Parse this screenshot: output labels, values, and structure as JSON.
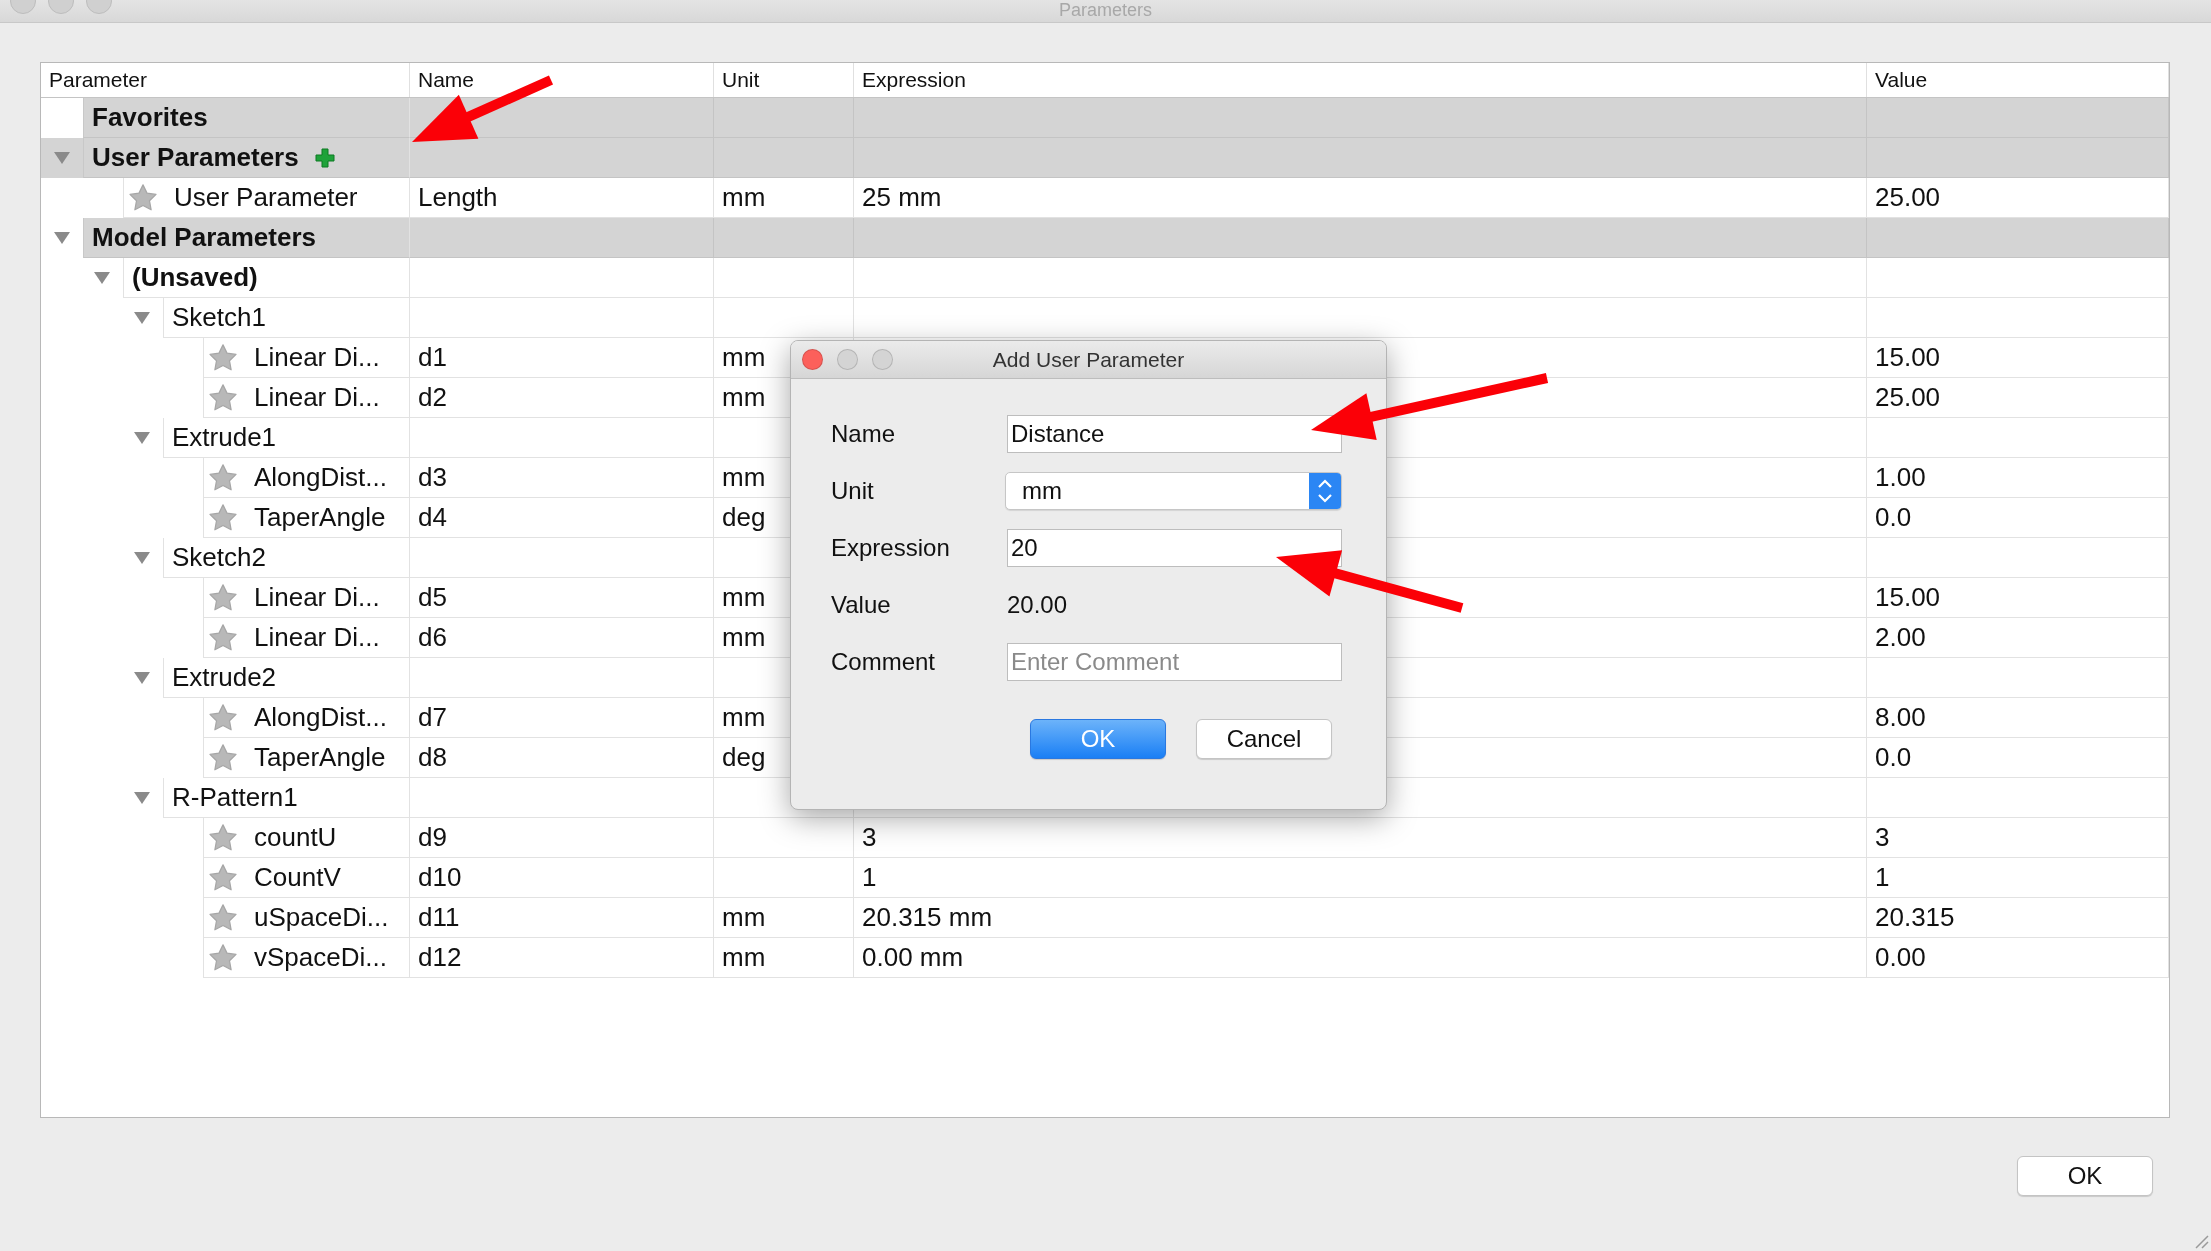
{
  "window": {
    "title": "Parameters"
  },
  "table": {
    "columns": [
      "Parameter",
      "Name",
      "Unit",
      "Expression",
      "Value"
    ],
    "rows": [
      {
        "kind": "group",
        "label": "Favorites"
      },
      {
        "kind": "group",
        "label": "User Parameters",
        "expanded": true,
        "add_icon": true,
        "children": [
          {
            "kind": "param",
            "label": "User Parameter",
            "name": "Length",
            "unit": "mm",
            "expression": "25 mm",
            "value": "25.00"
          }
        ]
      },
      {
        "kind": "group",
        "label": "Model Parameters",
        "expanded": true,
        "children": [
          {
            "kind": "document",
            "label": "(Unsaved)",
            "expanded": true,
            "children": [
              {
                "kind": "folder",
                "label": "Sketch1",
                "expanded": true,
                "children": [
                  {
                    "kind": "param",
                    "label": "Linear Di...",
                    "name": "d1",
                    "unit": "mm",
                    "value": "15.00"
                  },
                  {
                    "kind": "param",
                    "label": "Linear Di...",
                    "name": "d2",
                    "unit": "mm",
                    "value": "25.00"
                  }
                ]
              },
              {
                "kind": "folder",
                "label": "Extrude1",
                "expanded": true,
                "children": [
                  {
                    "kind": "param",
                    "label": "AlongDist...",
                    "name": "d3",
                    "unit": "mm",
                    "value": "1.00"
                  },
                  {
                    "kind": "param",
                    "label": "TaperAngle",
                    "name": "d4",
                    "unit": "deg",
                    "value": "0.0"
                  }
                ]
              },
              {
                "kind": "folder",
                "label": "Sketch2",
                "expanded": true,
                "children": [
                  {
                    "kind": "param",
                    "label": "Linear Di...",
                    "name": "d5",
                    "unit": "mm",
                    "value": "15.00"
                  },
                  {
                    "kind": "param",
                    "label": "Linear Di...",
                    "name": "d6",
                    "unit": "mm",
                    "value": "2.00"
                  }
                ]
              },
              {
                "kind": "folder",
                "label": "Extrude2",
                "expanded": true,
                "children": [
                  {
                    "kind": "param",
                    "label": "AlongDist...",
                    "name": "d7",
                    "unit": "mm",
                    "value": "8.00"
                  },
                  {
                    "kind": "param",
                    "label": "TaperAngle",
                    "name": "d8",
                    "unit": "deg",
                    "value": "0.0"
                  }
                ]
              },
              {
                "kind": "folder",
                "label": "R-Pattern1",
                "expanded": true,
                "children": [
                  {
                    "kind": "param",
                    "label": "countU",
                    "name": "d9",
                    "expression": "3",
                    "value": "3"
                  },
                  {
                    "kind": "param",
                    "label": "CountV",
                    "name": "d10",
                    "expression": "1",
                    "value": "1"
                  },
                  {
                    "kind": "param",
                    "label": "uSpaceDi...",
                    "name": "d11",
                    "unit": "mm",
                    "expression": "20.315 mm",
                    "value": "20.315"
                  },
                  {
                    "kind": "param",
                    "label": "vSpaceDi...",
                    "name": "d12",
                    "unit": "mm",
                    "expression": "0.00 mm",
                    "value": "0.00"
                  }
                ]
              }
            ]
          }
        ]
      }
    ]
  },
  "dialog": {
    "title": "Add User Parameter",
    "fields": [
      {
        "kind": "text",
        "label": "Name",
        "value": "Distance"
      },
      {
        "kind": "select",
        "label": "Unit",
        "value": "mm"
      },
      {
        "kind": "text",
        "label": "Expression",
        "value": "20"
      },
      {
        "kind": "readout",
        "label": "Value",
        "value": "20.00"
      },
      {
        "kind": "text",
        "label": "Comment",
        "placeholder": "Enter Comment"
      }
    ],
    "buttons": [
      {
        "label": "OK",
        "default": true
      },
      {
        "label": "Cancel",
        "default": false
      }
    ]
  },
  "footer": {
    "button": "OK"
  }
}
